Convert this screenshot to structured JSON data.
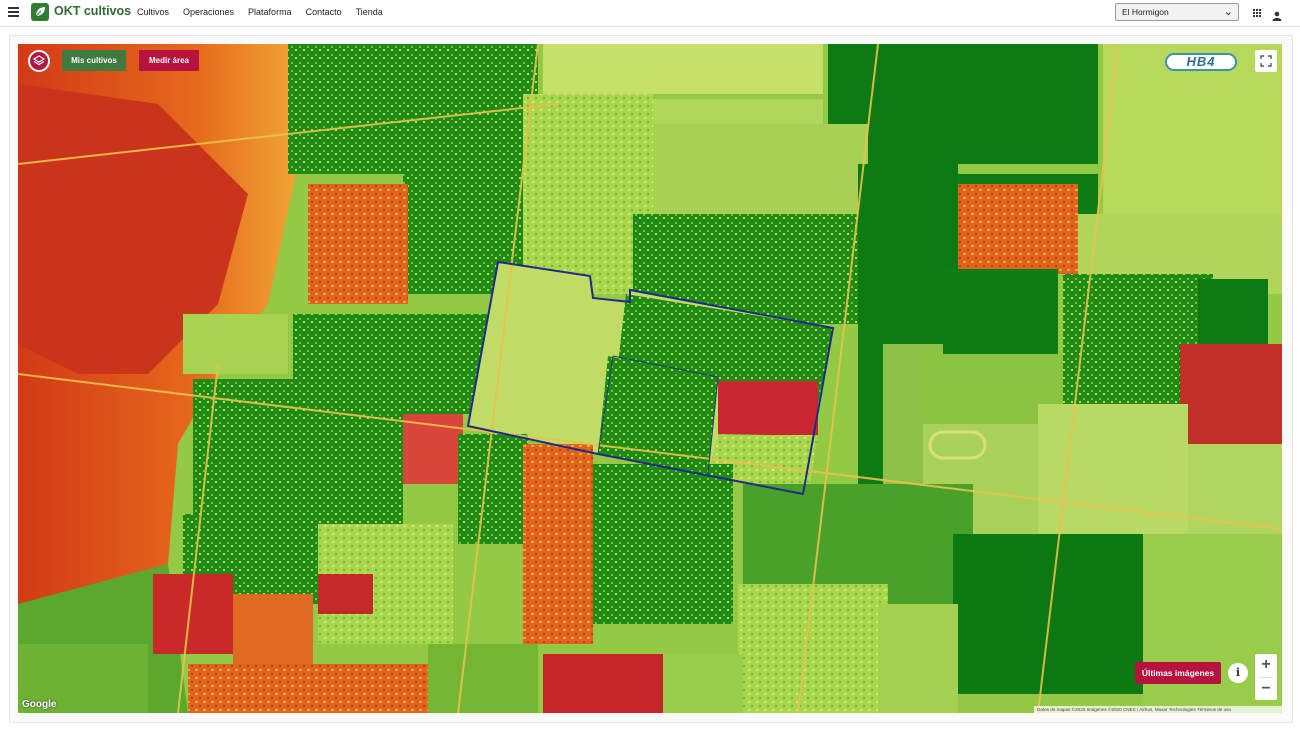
{
  "app": {
    "name": "OKT cultivos"
  },
  "nav": {
    "items": [
      "Cultivos",
      "Operaciones",
      "Plataforma",
      "Contacto",
      "Tienda"
    ]
  },
  "farm_selector": {
    "value": "El Hormigon"
  },
  "map": {
    "buttons": {
      "my_crops": "Mis cultivos",
      "measure_area": "Medir área",
      "latest_images": "Últimas imágenes",
      "zoom_in": "+",
      "zoom_out": "−",
      "info": "i"
    },
    "brand_badge": "HB4",
    "google_label": "Google",
    "attribution": "Datos de mapas ©2020 Imágenes ©2020 CNES / Airbus, Maxar Technologies   Términos de uso"
  },
  "colors": {
    "brand_green": "#3f7a3f",
    "brand_red": "#b8123e",
    "ndvi_high": "#0f7d0f",
    "ndvi_mid": "#9fd24a",
    "ndvi_low": "#d93a1c",
    "field_outline": "#1f2a8a"
  },
  "icons": {
    "menu": "hamburger-icon",
    "logo": "leaf-logo-icon",
    "apps": "apps-grid-icon",
    "user": "user-icon",
    "layers": "layers-icon",
    "fullscreen": "fullscreen-icon",
    "dropdown": "chevron-down-icon"
  }
}
